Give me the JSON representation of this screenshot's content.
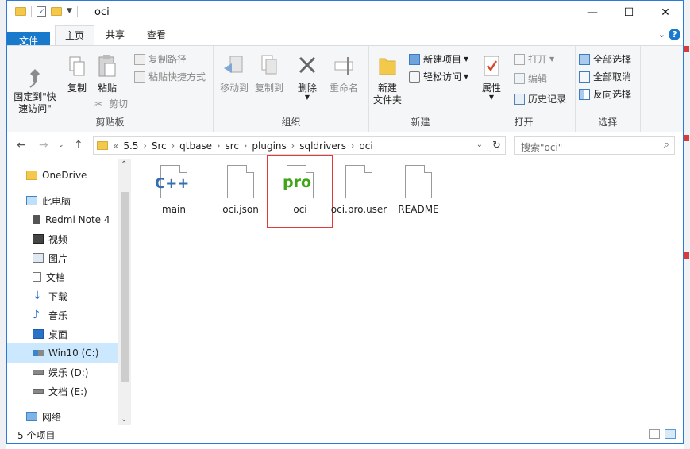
{
  "window": {
    "title": "oci",
    "minimize": "—",
    "maximize": "☐",
    "close": "✕"
  },
  "tabs": [
    "文件",
    "主页",
    "共享",
    "查看"
  ],
  "ribbon": {
    "clipboard": {
      "label": "剪贴板",
      "pin": "固定到\"快\n速访问\"",
      "copy": "复制",
      "paste": "粘贴",
      "copy_path": "复制路径",
      "paste_shortcut": "粘贴快捷方式",
      "cut": "剪切"
    },
    "organize": {
      "label": "组织",
      "move_to": "移动到",
      "copy_to": "复制到",
      "delete": "删除",
      "rename": "重命名"
    },
    "new": {
      "label": "新建",
      "new_folder": "新建\n文件夹",
      "new_item": "新建项目",
      "easy_access": "轻松访问"
    },
    "open": {
      "label": "打开",
      "properties": "属性",
      "open": "打开",
      "edit": "编辑",
      "history": "历史记录"
    },
    "select": {
      "label": "选择",
      "select_all": "全部选择",
      "select_none": "全部取消",
      "invert": "反向选择"
    }
  },
  "address": {
    "prefix": "«",
    "crumbs": [
      "5.5",
      "Src",
      "qtbase",
      "src",
      "plugins",
      "sqldrivers",
      "oci"
    ],
    "search_placeholder": "搜索\"oci\""
  },
  "nav": [
    {
      "label": "OneDrive",
      "icon": "folder-icon"
    },
    {
      "label": "此电脑",
      "icon": "computer-icon"
    },
    {
      "label": "Redmi Note 4",
      "icon": "phone-icon"
    },
    {
      "label": "视频",
      "icon": "video-icon"
    },
    {
      "label": "图片",
      "icon": "picture-icon"
    },
    {
      "label": "文档",
      "icon": "document-icon"
    },
    {
      "label": "下载",
      "icon": "download-icon"
    },
    {
      "label": "音乐",
      "icon": "music-icon"
    },
    {
      "label": "桌面",
      "icon": "desktop-icon"
    },
    {
      "label": "Win10 (C:)",
      "icon": "drive-c-icon"
    },
    {
      "label": "娱乐 (D:)",
      "icon": "drive-icon"
    },
    {
      "label": "文档 (E:)",
      "icon": "drive-icon"
    },
    {
      "label": "网络",
      "icon": "network-icon"
    }
  ],
  "files": [
    {
      "name": "main",
      "type": "cpp"
    },
    {
      "name": "oci.json",
      "type": "generic"
    },
    {
      "name": "oci",
      "type": "pro"
    },
    {
      "name": "oci.pro.user",
      "type": "generic"
    },
    {
      "name": "README",
      "type": "generic"
    }
  ],
  "file_marks": {
    "cpp": "C++",
    "pro": "pro"
  },
  "status": {
    "count": "5 个项目"
  },
  "colors": {
    "accent": "#1979ca",
    "selection": "#cce8ff",
    "highlight_box": "#e23a3a"
  }
}
